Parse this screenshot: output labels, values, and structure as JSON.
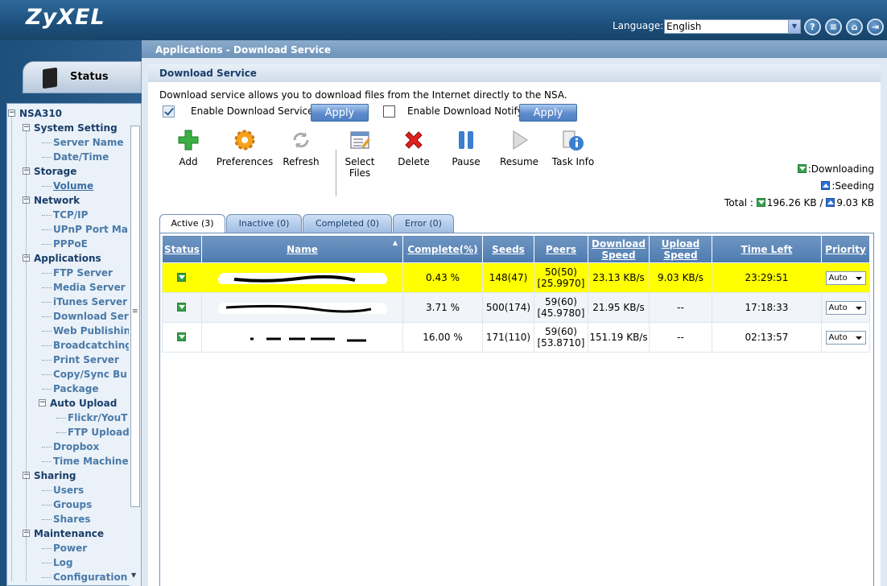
{
  "header": {
    "logo": "ZyXEL",
    "language_label": "Language:",
    "language_value": "English"
  },
  "left": {
    "status_label": "Status",
    "tree": [
      {
        "label": "NSA310",
        "level": 0,
        "type": "top"
      },
      {
        "label": "System Setting",
        "level": 1,
        "type": "top"
      },
      {
        "label": "Server Name",
        "level": 2,
        "type": "leaf"
      },
      {
        "label": "Date/Time",
        "level": 2,
        "type": "leaf"
      },
      {
        "label": "Storage",
        "level": 1,
        "type": "top"
      },
      {
        "label": "Volume",
        "level": 2,
        "type": "act"
      },
      {
        "label": "Network",
        "level": 1,
        "type": "top"
      },
      {
        "label": "TCP/IP",
        "level": 2,
        "type": "leaf"
      },
      {
        "label": "UPnP Port Map",
        "level": 2,
        "type": "leaf"
      },
      {
        "label": "PPPoE",
        "level": 2,
        "type": "leaf"
      },
      {
        "label": "Applications",
        "level": 1,
        "type": "top"
      },
      {
        "label": "FTP Server",
        "level": 2,
        "type": "leaf"
      },
      {
        "label": "Media Server",
        "level": 2,
        "type": "leaf"
      },
      {
        "label": "iTunes Server",
        "level": 2,
        "type": "leaf"
      },
      {
        "label": "Download Serv",
        "level": 2,
        "type": "leaf"
      },
      {
        "label": "Web Publishin",
        "level": 2,
        "type": "leaf"
      },
      {
        "label": "Broadcatching",
        "level": 2,
        "type": "leaf"
      },
      {
        "label": "Print Server",
        "level": 2,
        "type": "leaf"
      },
      {
        "label": "Copy/Sync Bu",
        "level": 2,
        "type": "leaf"
      },
      {
        "label": "Package",
        "level": 2,
        "type": "leaf"
      },
      {
        "label": "Auto Upload",
        "level": 2,
        "type": "top"
      },
      {
        "label": "Flickr/YouT",
        "level": 3,
        "type": "leaf"
      },
      {
        "label": "FTP Upload",
        "level": 3,
        "type": "leaf"
      },
      {
        "label": "Dropbox",
        "level": 2,
        "type": "leaf"
      },
      {
        "label": "Time Machine",
        "level": 2,
        "type": "leaf"
      },
      {
        "label": "Sharing",
        "level": 1,
        "type": "top"
      },
      {
        "label": "Users",
        "level": 2,
        "type": "leaf"
      },
      {
        "label": "Groups",
        "level": 2,
        "type": "leaf"
      },
      {
        "label": "Shares",
        "level": 2,
        "type": "leaf"
      },
      {
        "label": "Maintenance",
        "level": 1,
        "type": "top"
      },
      {
        "label": "Power",
        "level": 2,
        "type": "leaf"
      },
      {
        "label": "Log",
        "level": 2,
        "type": "leaf"
      },
      {
        "label": "Configuration",
        "level": 2,
        "type": "leaf"
      }
    ]
  },
  "main": {
    "breadcrumb": "Applications - Download Service",
    "pane_title": "Download Service",
    "description": "Download service allows you to download files from the Internet directly to the NSA.",
    "enable_download_label": "Enable Download Service",
    "enable_notify_label": "Enable Download Notify",
    "apply_label": "Apply",
    "toolbar": {
      "add": "Add",
      "preferences": "Preferences",
      "refresh": "Refresh",
      "select_files": "Select Files",
      "delete": "Delete",
      "pause": "Pause",
      "resume": "Resume",
      "task_info": "Task Info"
    },
    "legend": {
      "downloading": ":Downloading",
      "seeding": ":Seeding",
      "total_label": "Total :",
      "total_down": "196.26 KB",
      "sep": "/",
      "total_up": "9.03 KB"
    },
    "tabs": [
      "Active (3)",
      "Inactive (0)",
      "Completed (0)",
      "Error (0)"
    ],
    "columns": [
      "Status",
      "Name",
      "Complete(%)",
      "Seeds",
      "Peers",
      "Download Speed",
      "Upload Speed",
      "Time Left",
      "Priority"
    ],
    "rows": [
      {
        "complete": "0.43 %",
        "seeds": "148(47)",
        "peers1": "50(50)",
        "peers2": "[25.9970]",
        "down": "23.13 KB/s",
        "up": "9.03 KB/s",
        "left": "23:29:51",
        "priority": "Auto"
      },
      {
        "complete": "3.71 %",
        "seeds": "500(174)",
        "peers1": "59(60)",
        "peers2": "[45.9780]",
        "down": "21.95 KB/s",
        "up": "--",
        "left": "17:18:33",
        "priority": "Auto"
      },
      {
        "complete": "16.00 %",
        "seeds": "171(110)",
        "peers1": "59(60)",
        "peers2": "[53.8710]",
        "down": "151.19 KB/s",
        "up": "--",
        "left": "02:13:57",
        "priority": "Auto"
      }
    ]
  },
  "colors": {
    "header_bg": "#1d4f7c",
    "selected_row": "#ffff00",
    "table_header": "#5a86b8"
  }
}
